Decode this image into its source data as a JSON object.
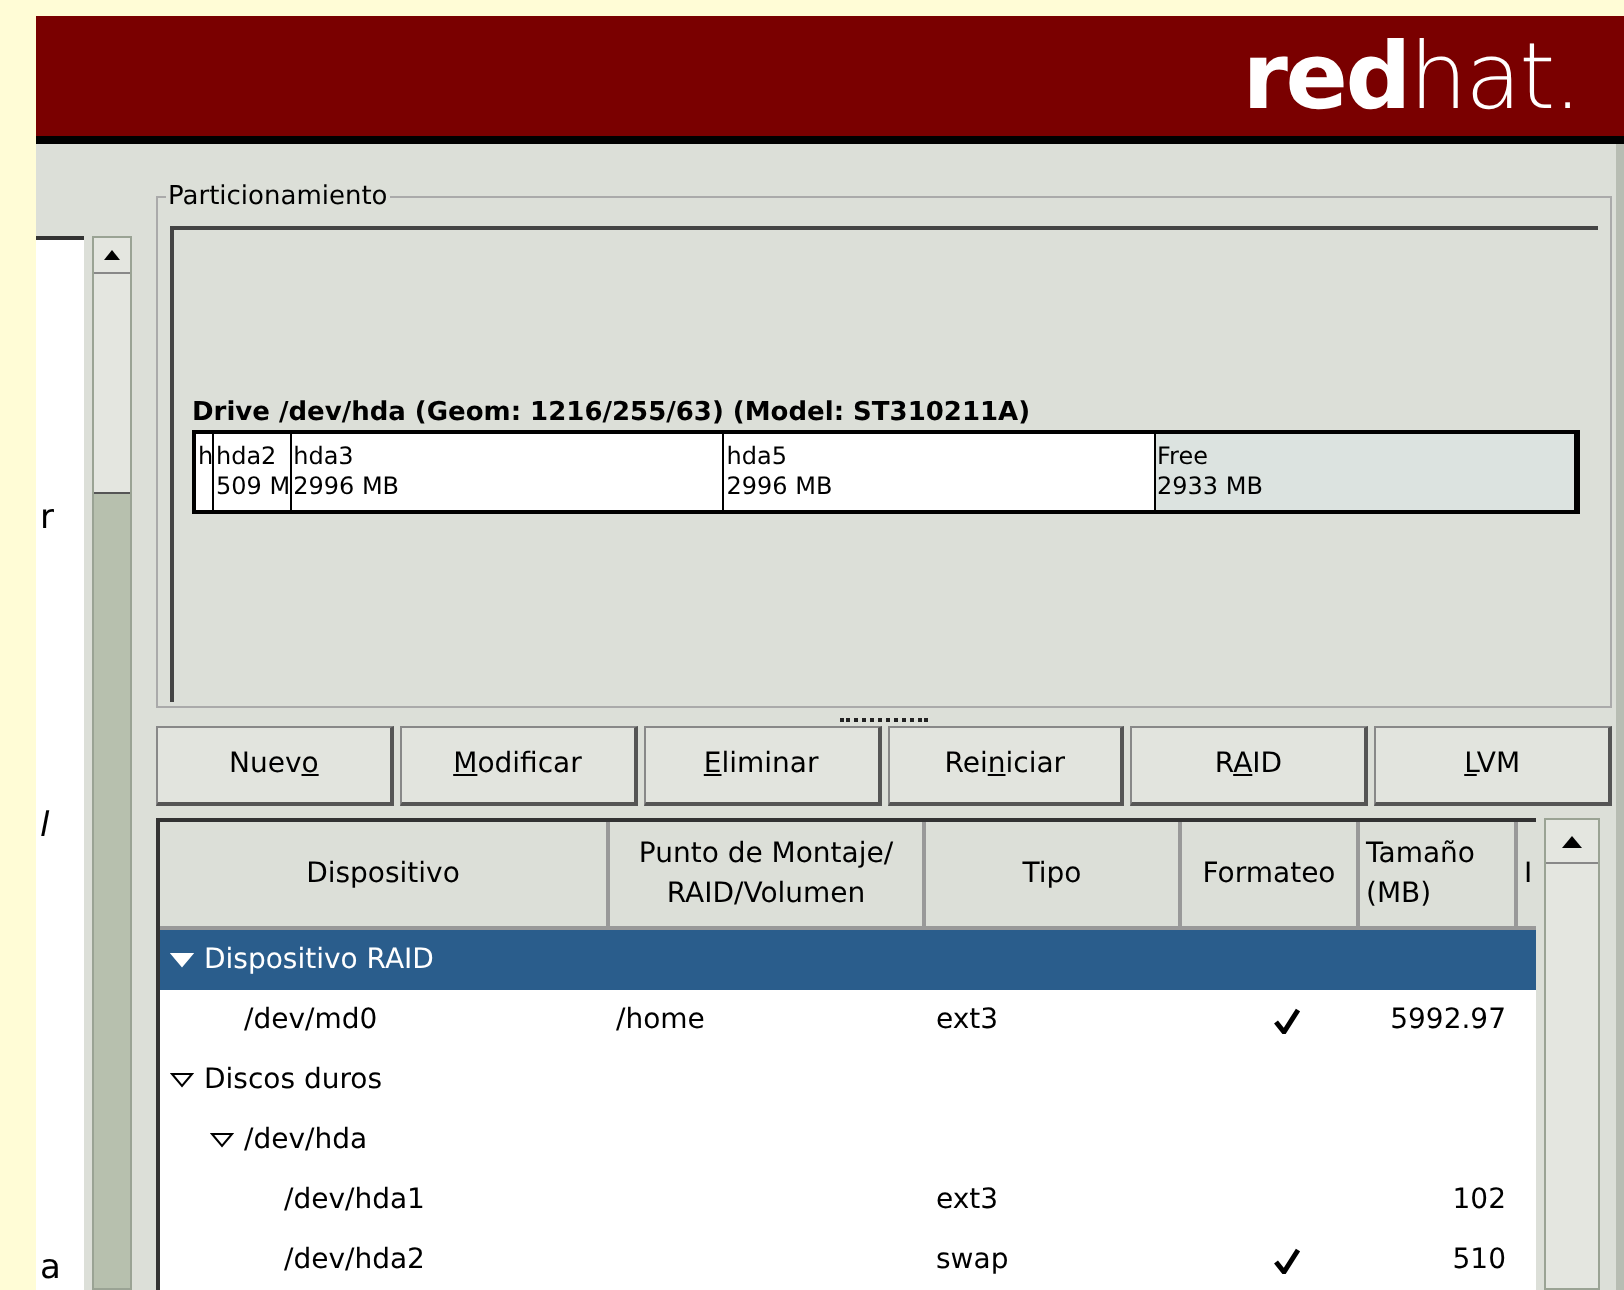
{
  "banner": {
    "logo_bold": "red",
    "logo_light": "hat."
  },
  "left_panel": {
    "fragments": [
      {
        "text": "r",
        "italic": false
      },
      {
        "text": "l",
        "italic": true
      },
      {
        "text": "a",
        "italic": false
      }
    ]
  },
  "partitioning": {
    "title": "Particionamiento",
    "drive_label": "Drive /dev/hda (Geom: 1216/255/63) (Model: ST310211A)",
    "segments": [
      {
        "name": "h",
        "free": false
      },
      {
        "name": "hda2",
        "size": "509 M",
        "free": false
      },
      {
        "name": "hda3",
        "size": "2996 MB",
        "free": false
      },
      {
        "name": "hda5",
        "size": "2996 MB",
        "free": false
      },
      {
        "name": "Free",
        "size": "2933 MB",
        "free": true
      }
    ]
  },
  "buttons": [
    {
      "parts": [
        {
          "text": "Nuev",
          "underlined": false
        },
        {
          "text": "o",
          "underlined": true
        }
      ]
    },
    {
      "parts": [
        {
          "text": "M",
          "underlined": true
        },
        {
          "text": "odificar",
          "underlined": false
        }
      ]
    },
    {
      "parts": [
        {
          "text": "E",
          "underlined": true
        },
        {
          "text": "liminar",
          "underlined": false
        }
      ]
    },
    {
      "parts": [
        {
          "text": "Rei",
          "underlined": false
        },
        {
          "text": "n",
          "underlined": true
        },
        {
          "text": "iciar",
          "underlined": false
        }
      ]
    },
    {
      "parts": [
        {
          "text": "R",
          "underlined": false
        },
        {
          "text": "A",
          "underlined": true
        },
        {
          "text": "ID",
          "underlined": false
        }
      ]
    },
    {
      "parts": [
        {
          "text": "L",
          "underlined": true
        },
        {
          "text": "VM",
          "underlined": false
        }
      ]
    }
  ],
  "table": {
    "columns": [
      "Dispositivo",
      "Punto de Montaje/ RAID/Volumen",
      "Tipo",
      "Formateo",
      "Tamaño (MB)",
      "I"
    ],
    "rows": [
      {
        "device": "Dispositivo RAID",
        "selected": true,
        "expanded": true,
        "children": [
          {
            "device": "/dev/md0",
            "mount": "/home",
            "type": "ext3",
            "formatted": true,
            "size": "5992.97",
            "selected": false
          }
        ]
      },
      {
        "device": "Discos duros",
        "selected": false,
        "expanded": true,
        "children": [
          {
            "device": "/dev/hda",
            "selected": false,
            "expanded": true,
            "children": [
              {
                "device": "/dev/hda1",
                "type": "ext3",
                "formatted": false,
                "size": "102",
                "selected": false
              },
              {
                "device": "/dev/hda2",
                "type": "swap",
                "formatted": true,
                "size": "510",
                "selected": false
              }
            ]
          }
        ]
      }
    ]
  }
}
